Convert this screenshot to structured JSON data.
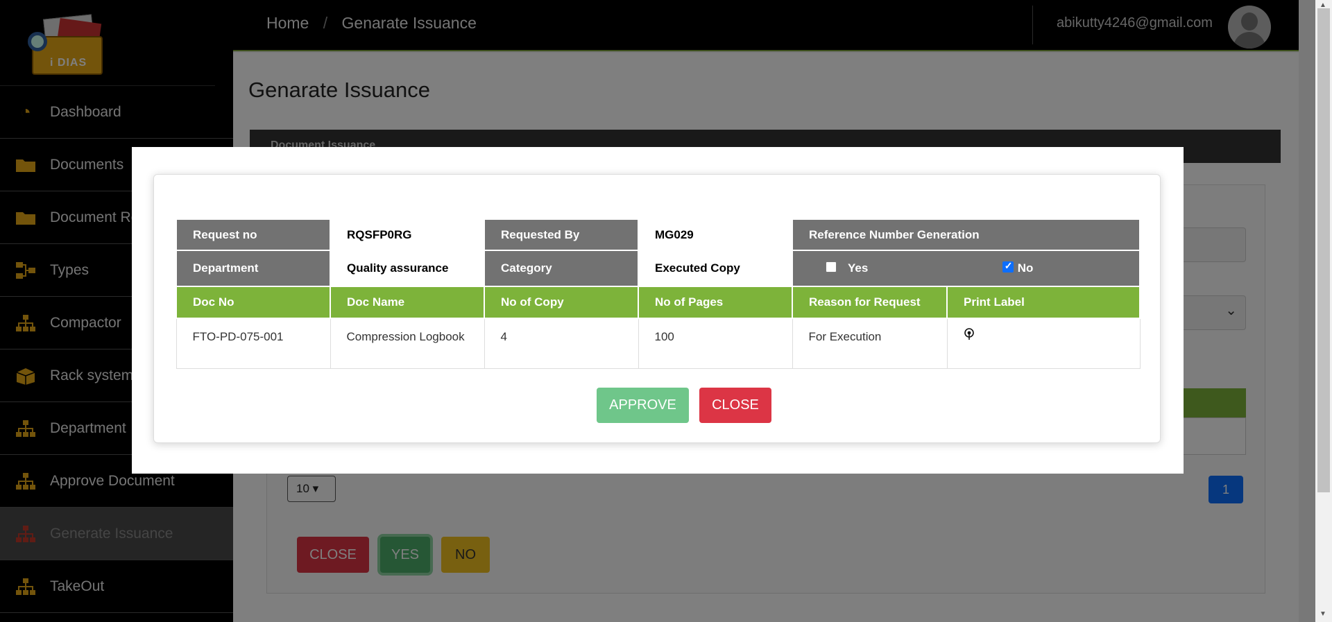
{
  "app": {
    "logo_text": "i DIAS"
  },
  "sidebar": {
    "items": [
      {
        "label": "Dashboard",
        "icon": "gauge-icon"
      },
      {
        "label": "Documents",
        "icon": "folder-icon"
      },
      {
        "label": "Document Re",
        "icon": "folder-icon"
      },
      {
        "label": "Types",
        "icon": "flow-icon"
      },
      {
        "label": "Compactor",
        "icon": "sitemap-icon"
      },
      {
        "label": "Rack system",
        "icon": "box-icon"
      },
      {
        "label": "Department",
        "icon": "sitemap-icon"
      },
      {
        "label": "Approve Document",
        "icon": "sitemap-icon"
      },
      {
        "label": "Generate Issuance",
        "icon": "sitemap-icon",
        "active": true
      },
      {
        "label": "TakeOut",
        "icon": "sitemap-icon"
      }
    ]
  },
  "header": {
    "breadcrumb": {
      "home": "Home",
      "separator": "/",
      "current": "Genarate Issuance"
    },
    "user_email": "abikutty4246@gmail.com"
  },
  "main": {
    "title": "Genarate Issuance",
    "card_header": "Document Issuance",
    "page_size": "10",
    "page_number": "1",
    "buttons": {
      "close": "CLOSE",
      "yes": "YES",
      "no": "NO"
    }
  },
  "modal": {
    "labels": {
      "request_no": "Request no",
      "requested_by": "Requested By",
      "ref_gen": "Reference Number Generation",
      "department": "Department",
      "category": "Category",
      "yes": "Yes",
      "no": "No"
    },
    "values": {
      "request_no": "RQSFP0RG",
      "requested_by": "MG029",
      "department": "Quality assurance",
      "category": "Executed Copy",
      "ref_gen_yes": false,
      "ref_gen_no": true
    },
    "columns": [
      "Doc No",
      "Doc Name",
      "No of Copy",
      "No of Pages",
      "Reason for Request",
      "Print Label"
    ],
    "rows": [
      {
        "doc_no": "FTO-PD-075-001",
        "doc_name": "Compression Logbook",
        "copies": "4",
        "pages": "100",
        "reason": "For Execution",
        "print_icon": "print-label-icon"
      }
    ],
    "buttons": {
      "approve": "APPROVE",
      "close": "CLOSE"
    }
  },
  "colors": {
    "accent_green": "#7db33a",
    "header_gray": "#727272",
    "danger": "#dc3545",
    "approve": "#6fc68a",
    "icon_gold": "#e6a817"
  }
}
